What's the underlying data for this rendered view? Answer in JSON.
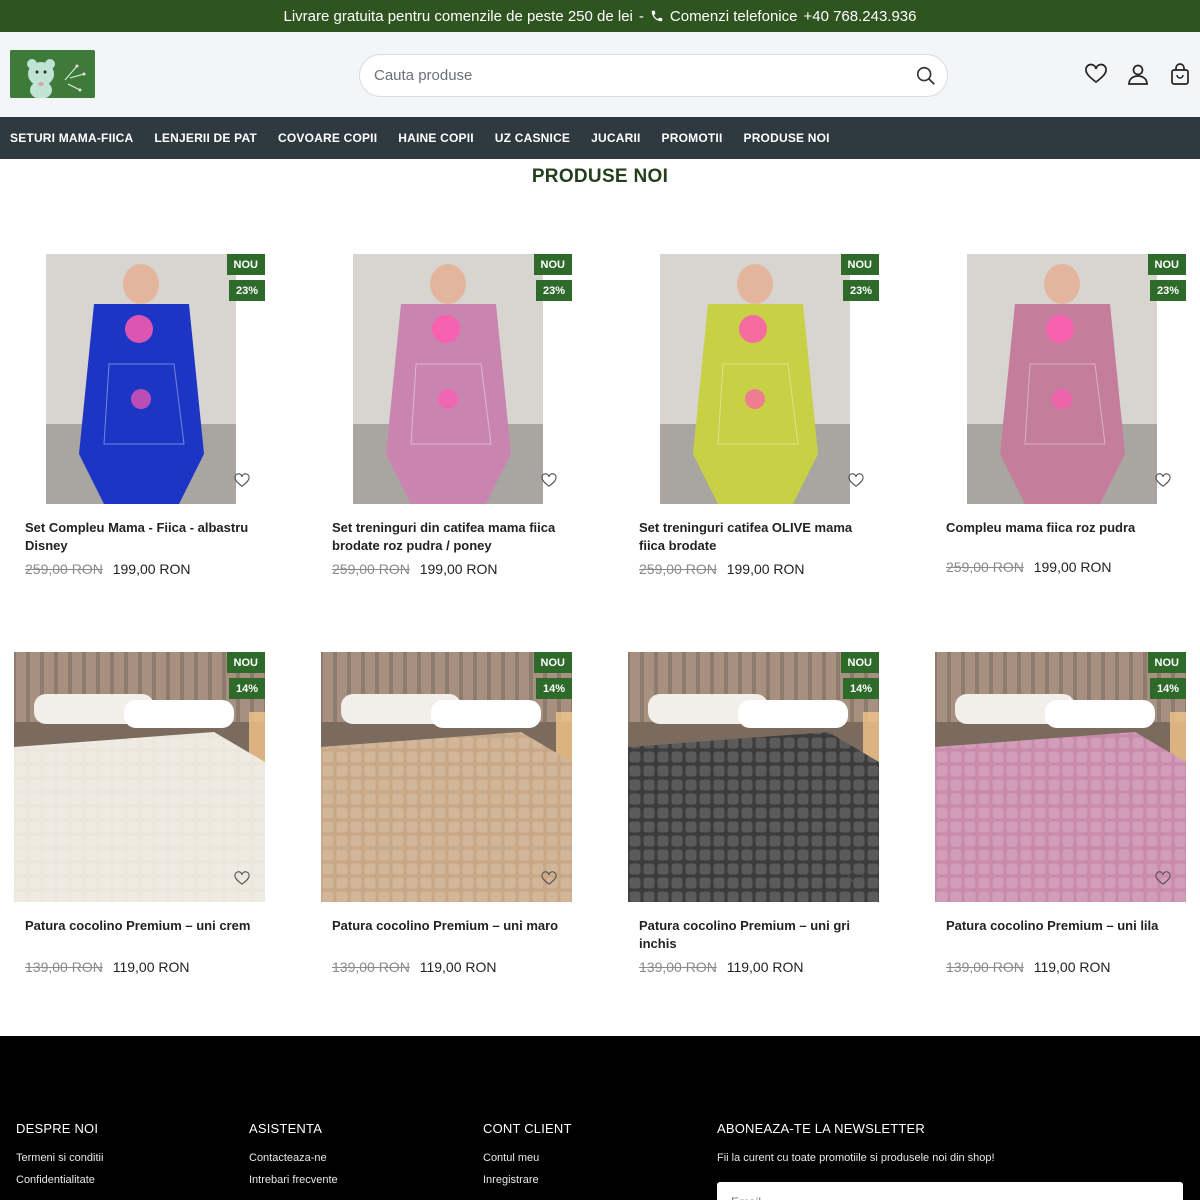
{
  "topbar": {
    "shipping_text": "Livrare gratuita pentru comenzile de peste 250 de lei",
    "separator": "-",
    "phone_label": "Comenzi telefonice",
    "phone_number": "+40 768.243.936"
  },
  "header": {
    "search_placeholder": "Cauta produse"
  },
  "nav": {
    "items": [
      "SETURI MAMA-FIICA",
      "LENJERII DE PAT",
      "COVOARE COPII",
      "HAINE COPII",
      "UZ CASNICE",
      "JUCARII",
      "PROMOTII",
      "PRODUSE NOI"
    ]
  },
  "section": {
    "title": "PRODUSE NOI"
  },
  "products": [
    {
      "name": "Set Compleu Mama - Fiica - albastru Disney",
      "badge": "NOU",
      "discount": "23%",
      "old_price": "259,00 RON",
      "price": "199,00 RON",
      "color": "#1d35c4"
    },
    {
      "name": "Set treninguri din catifea mama fiica brodate roz pudra / poney",
      "badge": "NOU",
      "discount": "23%",
      "old_price": "259,00 RON",
      "price": "199,00 RON",
      "color": "#c985b0"
    },
    {
      "name": "Set treninguri catifea OLIVE mama fiica brodate",
      "badge": "NOU",
      "discount": "23%",
      "old_price": "259,00 RON",
      "price": "199,00 RON",
      "color": "#c8d045"
    },
    {
      "name": "Compleu mama fiica roz pudra",
      "badge": "NOU",
      "discount": "23%",
      "old_price": "259,00 RON",
      "price": "199,00 RON",
      "color": "#c47d9b"
    },
    {
      "name": "Patura cocolino Premium – uni crem",
      "badge": "NOU",
      "discount": "14%",
      "old_price": "139,00 RON",
      "price": "119,00 RON",
      "color": "#ece7dc"
    },
    {
      "name": "Patura cocolino Premium – uni maro",
      "badge": "NOU",
      "discount": "14%",
      "old_price": "139,00 RON",
      "price": "119,00 RON",
      "color": "#c9a887"
    },
    {
      "name": "Patura cocolino Premium – uni gri inchis",
      "badge": "NOU",
      "discount": "14%",
      "old_price": "139,00 RON",
      "price": "119,00 RON",
      "color": "#3c3c3c"
    },
    {
      "name": "Patura cocolino Premium – uni lila",
      "badge": "NOU",
      "discount": "14%",
      "old_price": "139,00 RON",
      "price": "119,00 RON",
      "color": "#c98aab"
    }
  ],
  "footer": {
    "col1": {
      "title": "DESPRE NOI",
      "links": [
        "Termeni si conditii",
        "Confidentialitate"
      ]
    },
    "col2": {
      "title": "ASISTENTA",
      "links": [
        "Contacteaza-ne",
        "Intrebari frecvente"
      ]
    },
    "col3": {
      "title": "CONT CLIENT",
      "links": [
        "Contul meu",
        "Inregistrare"
      ]
    },
    "newsletter": {
      "title": "ABONEAZA-TE LA NEWSLETTER",
      "text": "Fii la curent cu toate promotiile si produsele noi din shop!",
      "placeholder": "Email"
    }
  },
  "colors": {
    "brand_green": "#2e5520",
    "nav_bg": "#2f3a40",
    "badge_green": "#2e6a2a"
  }
}
